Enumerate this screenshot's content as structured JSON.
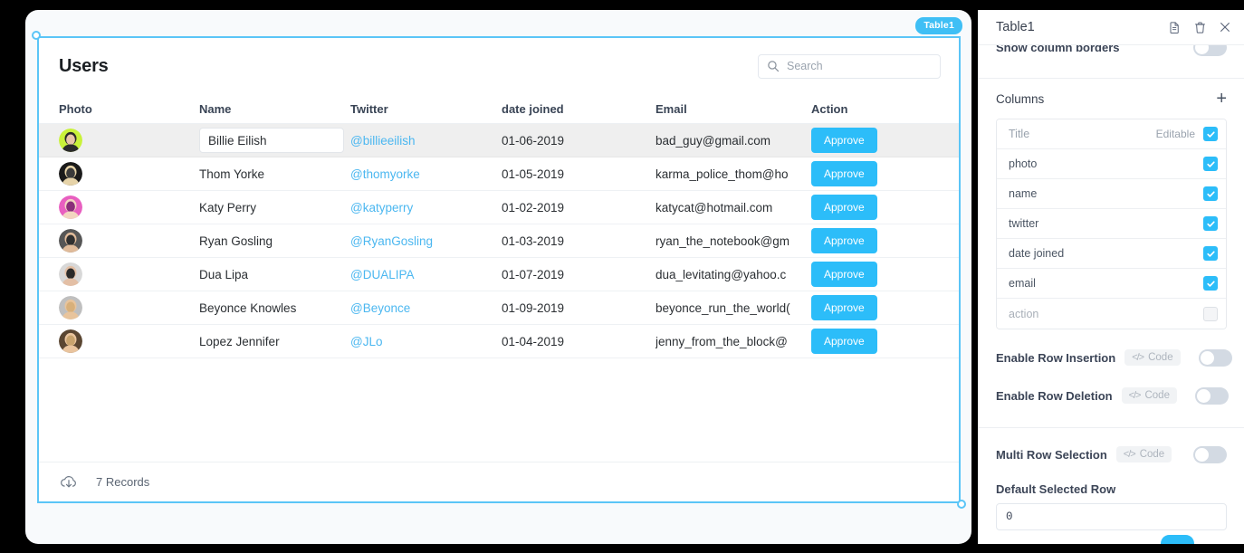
{
  "widget": {
    "badge": "Table1",
    "title": "Users",
    "search": {
      "placeholder": "Search",
      "value": ""
    },
    "columns": [
      "Photo",
      "Name",
      "Twitter",
      "date joined",
      "Email",
      "Action"
    ],
    "rows": [
      {
        "photo": "avatar-billie",
        "name": "Billie Eilish",
        "twitter": "@billieeilish",
        "date": "01-06-2019",
        "email": "bad_guy@gmail.com",
        "action": "Approve",
        "selected": true,
        "name_editing": true
      },
      {
        "photo": "avatar-thom",
        "name": "Thom Yorke",
        "twitter": "@thomyorke",
        "date": "01-05-2019",
        "email": "karma_police_thom@ho",
        "action": "Approve",
        "selected": false,
        "name_editing": false
      },
      {
        "photo": "avatar-katy",
        "name": "Katy Perry",
        "twitter": "@katyperry",
        "date": "01-02-2019",
        "email": "katycat@hotmail.com",
        "action": "Approve",
        "selected": false,
        "name_editing": false
      },
      {
        "photo": "avatar-ryan",
        "name": "Ryan Gosling",
        "twitter": "@RyanGosling",
        "date": "01-03-2019",
        "email": "ryan_the_notebook@gm",
        "action": "Approve",
        "selected": false,
        "name_editing": false
      },
      {
        "photo": "avatar-dua",
        "name": "Dua Lipa",
        "twitter": "@DUALIPA",
        "date": "01-07-2019",
        "email": "dua_levitating@yahoo.c",
        "action": "Approve",
        "selected": false,
        "name_editing": false
      },
      {
        "photo": "avatar-bey",
        "name": "Beyonce Knowles",
        "twitter": "@Beyonce",
        "date": "01-09-2019",
        "email": "beyonce_run_the_world(",
        "action": "Approve",
        "selected": false,
        "name_editing": false
      },
      {
        "photo": "avatar-jlo",
        "name": "Lopez Jennifer",
        "twitter": "@JLo",
        "date": "01-04-2019",
        "email": "jenny_from_the_block@",
        "action": "Approve",
        "selected": false,
        "name_editing": false
      }
    ],
    "footer": {
      "icon": "cloud-download-icon",
      "records_label": "7 Records"
    }
  },
  "panel": {
    "title": "Table1",
    "icons": [
      "duplicate-icon",
      "trash-icon",
      "close-icon"
    ],
    "show_column_borders": {
      "label": "Show column borders",
      "value": false
    },
    "columns_section": {
      "title": "Columns",
      "add_icon": "plus-icon"
    },
    "columns_list": [
      {
        "name": "Title",
        "editable_label": "Editable",
        "checked": true,
        "is_header": true,
        "disabled": false
      },
      {
        "name": "photo",
        "editable_label": "",
        "checked": true,
        "is_header": false,
        "disabled": false
      },
      {
        "name": "name",
        "editable_label": "",
        "checked": true,
        "is_header": false,
        "disabled": false
      },
      {
        "name": "twitter",
        "editable_label": "",
        "checked": true,
        "is_header": false,
        "disabled": false
      },
      {
        "name": "date joined",
        "editable_label": "",
        "checked": true,
        "is_header": false,
        "disabled": false
      },
      {
        "name": "email",
        "editable_label": "",
        "checked": true,
        "is_header": false,
        "disabled": false
      },
      {
        "name": "action",
        "editable_label": "",
        "checked": false,
        "is_header": false,
        "disabled": true
      }
    ],
    "settings": [
      {
        "label": "Enable Row Insertion",
        "code_label": "Code",
        "value": false
      },
      {
        "label": "Enable Row Deletion",
        "code_label": "Code",
        "value": false
      },
      {
        "label": "Multi Row Selection",
        "code_label": "Code",
        "value": false
      }
    ],
    "default_selected_row": {
      "label": "Default Selected Row",
      "value": "0"
    }
  },
  "colors": {
    "accent": "#2CBDF9",
    "selection": "#5BC5F7",
    "link": "#4BB7F0",
    "header_text": "#394455",
    "canvas": "#F8FAFC",
    "background": "#000000"
  }
}
